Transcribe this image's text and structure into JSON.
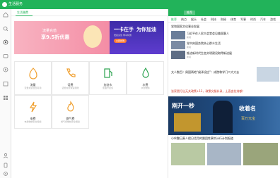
{
  "window": {
    "title": "生活服务"
  },
  "left_tabs": [
    {
      "label": "生活缴费"
    }
  ],
  "banner": {
    "left_text_line1": "流量充值",
    "left_text_line2": "享9.5折优惠",
    "right_text_line1": "一卡在手",
    "right_text_line2": "为你加油",
    "right_text_line3": "便捷充值 尊享特惠",
    "right_button": "立即抢购"
  },
  "services": [
    {
      "label": "流量",
      "sub": "流量充值全国可用"
    },
    {
      "label": "话费",
      "sub": "话费充值快速到账"
    },
    {
      "label": "加油卡",
      "sub": "加油卡充值"
    },
    {
      "label": "水费",
      "sub": "水费缴纳"
    },
    {
      "label": "电费",
      "sub": "电费缴纳安全便捷"
    },
    {
      "label": "燃气费",
      "sub": "燃气费缴纳安全便捷"
    }
  ],
  "right_panel": {
    "header_tab": "推荐",
    "tabs": [
      "推荐",
      "热点",
      "娱乐",
      "社会",
      "科技",
      "财经",
      "体育",
      "军事",
      "时尚",
      "汽车",
      "游戏"
    ],
    "news": [
      {
        "title": "党和国家文化事业发展",
        "meta": ""
      },
      {
        "title": "习近平在人民大会堂会见美国客人",
        "meta": "新闻"
      },
      {
        "title": "党中央国务院关心群众生活",
        "meta": "新闻"
      },
      {
        "title": "推进新时代生态文明建设取得新进展",
        "meta": "新闻"
      },
      {
        "title": "太人数百！周国两地“候泽设应”：成院和学门二大大去",
        "meta": ""
      },
      {
        "title": "张家贾打出无关政策+13，政策交服补录，土直由拉持额！",
        "meta": ""
      },
      {
        "title": "刚开一秒 回收着名",
        "meta": ""
      },
      {
        "title": "小伙整日真人假日话用的跟团性事实计行计划报道",
        "meta": ""
      }
    ],
    "promo": {
      "line1": "刚开一秒",
      "line2": "收着名",
      "line3": "百万元宝"
    }
  }
}
